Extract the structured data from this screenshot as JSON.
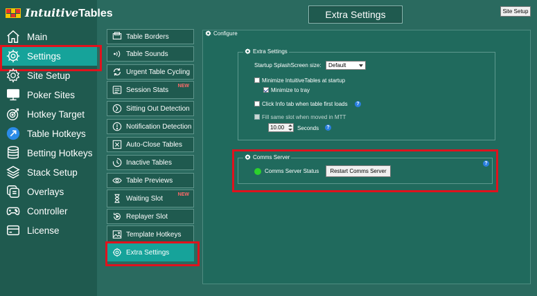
{
  "app": {
    "brand_prefix": "Intuitive",
    "brand_suffix": "Tables"
  },
  "header": {
    "title": "Extra Settings",
    "site_setup_label": "Site Setup"
  },
  "sidebar": {
    "items": [
      {
        "label": "Main",
        "icon": "home-icon"
      },
      {
        "label": "Settings",
        "icon": "gear-icon",
        "active": true
      },
      {
        "label": "Site Setup",
        "icon": "cog-outline-icon"
      },
      {
        "label": "Poker Sites",
        "icon": "monitor-icon"
      },
      {
        "label": "Hotkey Target",
        "icon": "target-icon"
      },
      {
        "label": "Table Hotkeys",
        "icon": "cursor-icon"
      },
      {
        "label": "Betting Hotkeys",
        "icon": "database-icon"
      },
      {
        "label": "Stack Setup",
        "icon": "layers-icon"
      },
      {
        "label": "Overlays",
        "icon": "overlay-icon"
      },
      {
        "label": "Controller",
        "icon": "gamepad-icon"
      },
      {
        "label": "License",
        "icon": "card-icon"
      }
    ]
  },
  "middle": {
    "items": [
      {
        "label": "Table Borders",
        "icon": "borders-icon"
      },
      {
        "label": "Table Sounds",
        "icon": "sound-icon"
      },
      {
        "label": "Urgent Table Cycling",
        "icon": "cycle-icon"
      },
      {
        "label": "Session Stats",
        "icon": "stats-icon",
        "badge": "NEW"
      },
      {
        "label": "Sitting Out Detection",
        "icon": "sitting-out-icon"
      },
      {
        "label": "Notification Detection",
        "icon": "alert-icon"
      },
      {
        "label": "Auto-Close Tables",
        "icon": "close-box-icon"
      },
      {
        "label": "Inactive Tables",
        "icon": "timer-icon"
      },
      {
        "label": "Table Previews",
        "icon": "eye-icon"
      },
      {
        "label": "Waiting Slot",
        "icon": "hourglass-icon",
        "badge": "NEW"
      },
      {
        "label": "Replayer Slot",
        "icon": "replay-icon"
      },
      {
        "label": "Template Hotkeys",
        "icon": "image-icon"
      },
      {
        "label": "Extra Settings",
        "icon": "settings-icon",
        "active": true
      }
    ]
  },
  "configure": {
    "title": "Configure",
    "extra": {
      "title": "Extra Settings",
      "splash_label": "Startup SplashScreen size:",
      "splash_value": "Default",
      "minimize_label": "Minimize IntuitiveTables at startup",
      "minimize_checked": false,
      "tray_label": "Minimize to tray",
      "tray_checked": true,
      "clickinfo_label": "Click Info tab when table first loads",
      "clickinfo_checked": false,
      "fill_label": "Fill same slot when moved in MTT",
      "fill_checked": false,
      "seconds_value": "10.00",
      "seconds_label": "Seconds"
    },
    "comms": {
      "title": "Comms Server",
      "status_label": "Comms Server Status",
      "restart_label": "Restart Comms Server"
    }
  },
  "colors": {
    "accent": "#16a39a",
    "highlight": "#e0121d",
    "status_ok": "#2cd12c"
  }
}
